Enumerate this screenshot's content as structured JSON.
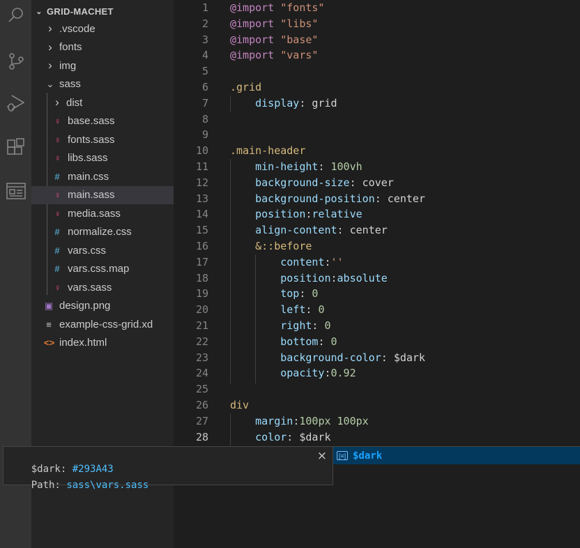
{
  "activity_bar": {
    "icons": [
      "search-icon",
      "source-control-icon",
      "run-debug-icon",
      "extensions-icon",
      "remote-explorer-icon"
    ]
  },
  "explorer": {
    "root_label": "GRID-MACHET",
    "items": [
      {
        "label": ".vscode",
        "type": "folder",
        "expanded": false
      },
      {
        "label": "fonts",
        "type": "folder",
        "expanded": false
      },
      {
        "label": "img",
        "type": "folder",
        "expanded": false
      },
      {
        "label": "sass",
        "type": "folder",
        "expanded": true
      },
      {
        "label": "dist",
        "type": "folder",
        "expanded": false
      },
      {
        "label": "base.sass",
        "type": "sass"
      },
      {
        "label": "fonts.sass",
        "type": "sass"
      },
      {
        "label": "libs.sass",
        "type": "sass"
      },
      {
        "label": "main.css",
        "type": "css"
      },
      {
        "label": "main.sass",
        "type": "sass",
        "selected": true
      },
      {
        "label": "media.sass",
        "type": "sass"
      },
      {
        "label": "normalize.css",
        "type": "css"
      },
      {
        "label": "vars.css",
        "type": "css"
      },
      {
        "label": "vars.css.map",
        "type": "css"
      },
      {
        "label": "vars.sass",
        "type": "sass"
      },
      {
        "label": "design.png",
        "type": "png"
      },
      {
        "label": "example-css-grid.xd",
        "type": "xd"
      },
      {
        "label": "index.html",
        "type": "html"
      }
    ]
  },
  "editor": {
    "active_line": 28,
    "lines": [
      {
        "n": "1",
        "tokens": [
          [
            "kw",
            "@import"
          ],
          [
            "punc",
            " "
          ],
          [
            "str",
            "\"fonts\""
          ]
        ]
      },
      {
        "n": "2",
        "tokens": [
          [
            "kw",
            "@import"
          ],
          [
            "punc",
            " "
          ],
          [
            "str",
            "\"libs\""
          ]
        ]
      },
      {
        "n": "3",
        "tokens": [
          [
            "kw",
            "@import"
          ],
          [
            "punc",
            " "
          ],
          [
            "str",
            "\"base\""
          ]
        ]
      },
      {
        "n": "4",
        "tokens": [
          [
            "kw",
            "@import"
          ],
          [
            "punc",
            " "
          ],
          [
            "str",
            "\"vars\""
          ]
        ]
      },
      {
        "n": "5",
        "tokens": []
      },
      {
        "n": "6",
        "tokens": [
          [
            "sel",
            ".grid"
          ]
        ]
      },
      {
        "n": "7",
        "tokens": [
          [
            "punc",
            "    "
          ],
          [
            "prop",
            "display"
          ],
          [
            "punc",
            ": "
          ],
          [
            "val",
            "grid"
          ]
        ]
      },
      {
        "n": "8",
        "tokens": []
      },
      {
        "n": "9",
        "tokens": []
      },
      {
        "n": "10",
        "tokens": [
          [
            "sel",
            ".main-header"
          ]
        ]
      },
      {
        "n": "11",
        "tokens": [
          [
            "punc",
            "    "
          ],
          [
            "prop",
            "min-height"
          ],
          [
            "punc",
            ": "
          ],
          [
            "num",
            "100"
          ],
          [
            "unit",
            "vh"
          ]
        ]
      },
      {
        "n": "12",
        "tokens": [
          [
            "punc",
            "    "
          ],
          [
            "prop",
            "background-size"
          ],
          [
            "punc",
            ": "
          ],
          [
            "val",
            "cover"
          ]
        ]
      },
      {
        "n": "13",
        "tokens": [
          [
            "punc",
            "    "
          ],
          [
            "prop",
            "background-position"
          ],
          [
            "punc",
            ": "
          ],
          [
            "val",
            "center"
          ]
        ]
      },
      {
        "n": "14",
        "tokens": [
          [
            "punc",
            "    "
          ],
          [
            "prop",
            "position"
          ],
          [
            "punc",
            ":"
          ],
          [
            "prop",
            "relative"
          ]
        ]
      },
      {
        "n": "15",
        "tokens": [
          [
            "punc",
            "    "
          ],
          [
            "prop",
            "align-content"
          ],
          [
            "punc",
            ": "
          ],
          [
            "val",
            "center"
          ]
        ]
      },
      {
        "n": "16",
        "tokens": [
          [
            "punc",
            "    "
          ],
          [
            "sel",
            "&::before"
          ]
        ]
      },
      {
        "n": "17",
        "tokens": [
          [
            "punc",
            "        "
          ],
          [
            "prop",
            "content"
          ],
          [
            "punc",
            ":"
          ],
          [
            "str",
            "''"
          ]
        ]
      },
      {
        "n": "18",
        "tokens": [
          [
            "punc",
            "        "
          ],
          [
            "prop",
            "position"
          ],
          [
            "punc",
            ":"
          ],
          [
            "prop",
            "absolute"
          ]
        ]
      },
      {
        "n": "19",
        "tokens": [
          [
            "punc",
            "        "
          ],
          [
            "prop",
            "top"
          ],
          [
            "punc",
            ": "
          ],
          [
            "num",
            "0"
          ]
        ]
      },
      {
        "n": "20",
        "tokens": [
          [
            "punc",
            "        "
          ],
          [
            "prop",
            "left"
          ],
          [
            "punc",
            ": "
          ],
          [
            "num",
            "0"
          ]
        ]
      },
      {
        "n": "21",
        "tokens": [
          [
            "punc",
            "        "
          ],
          [
            "prop",
            "right"
          ],
          [
            "punc",
            ": "
          ],
          [
            "num",
            "0"
          ]
        ]
      },
      {
        "n": "22",
        "tokens": [
          [
            "punc",
            "        "
          ],
          [
            "prop",
            "bottom"
          ],
          [
            "punc",
            ": "
          ],
          [
            "num",
            "0"
          ]
        ]
      },
      {
        "n": "23",
        "tokens": [
          [
            "punc",
            "        "
          ],
          [
            "prop",
            "background-color"
          ],
          [
            "punc",
            ": "
          ],
          [
            "var",
            "$dark"
          ]
        ]
      },
      {
        "n": "24",
        "tokens": [
          [
            "punc",
            "        "
          ],
          [
            "prop",
            "opacity"
          ],
          [
            "punc",
            ":"
          ],
          [
            "num",
            "0.92"
          ]
        ]
      },
      {
        "n": "25",
        "tokens": []
      },
      {
        "n": "26",
        "tokens": [
          [
            "sel",
            "div"
          ]
        ]
      },
      {
        "n": "27",
        "tokens": [
          [
            "punc",
            "    "
          ],
          [
            "prop",
            "margin"
          ],
          [
            "punc",
            ":"
          ],
          [
            "num",
            "100"
          ],
          [
            "unit",
            "px"
          ],
          [
            "punc",
            " "
          ],
          [
            "num",
            "100"
          ],
          [
            "unit",
            "px"
          ]
        ]
      },
      {
        "n": "28",
        "tokens": [
          [
            "punc",
            "    "
          ],
          [
            "prop",
            "color"
          ],
          [
            "punc",
            ": "
          ],
          [
            "var",
            "$dark"
          ]
        ]
      }
    ]
  },
  "suggestion": {
    "icon": "variable-icon",
    "label": "$dark"
  },
  "hover_tooltip": {
    "var_name": "$dark:",
    "var_value": "#293A43",
    "path_label": "Path:",
    "path_value": "sass\\vars.sass",
    "close_label": "×"
  }
}
